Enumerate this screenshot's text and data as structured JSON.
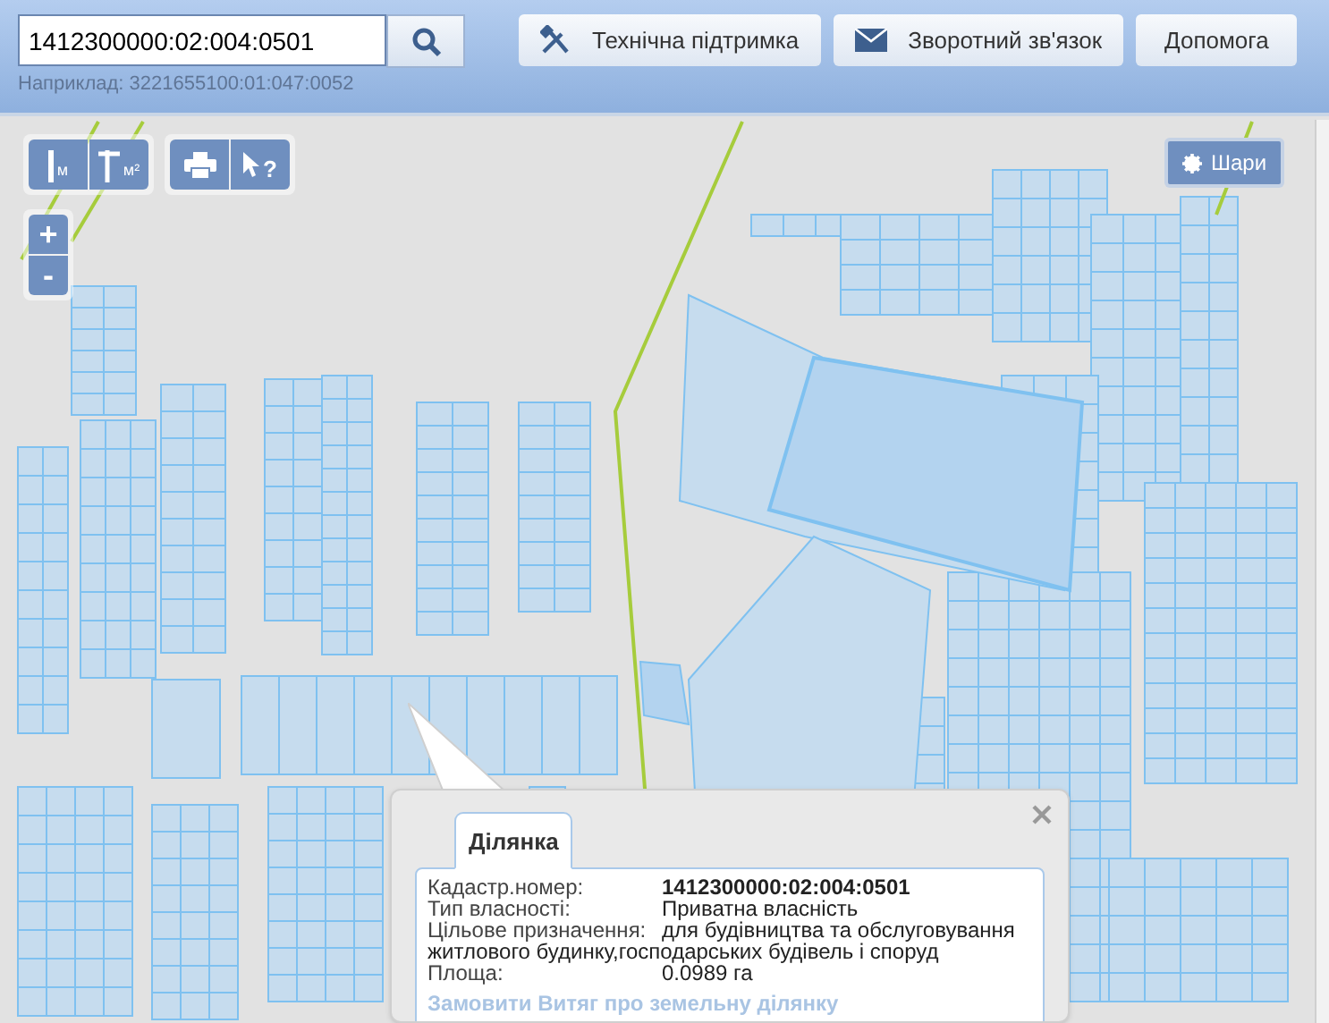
{
  "search": {
    "value": "1412300000:02:004:0501",
    "hint": "Наприклад: 3221655100:01:047:0052"
  },
  "header_buttons": [
    {
      "kind": "support",
      "label": "Технічна підтримка"
    },
    {
      "kind": "feedback",
      "label": "Зворотний зв'язок"
    },
    {
      "kind": "help",
      "label": "Допомога"
    }
  ],
  "measure_tools": [
    "м",
    "м²"
  ],
  "identify_tool": "?",
  "zoom": [
    "+",
    "-"
  ],
  "layers_button": "Шари",
  "popup": {
    "tabs": [
      {
        "label": "Ділянка",
        "selected": true
      }
    ],
    "fields": [
      {
        "label": "Кадастр.номер:",
        "value": "1412300000:02:004:0501",
        "bold": true
      },
      {
        "label": "Тип власності:",
        "value": "Приватна власність",
        "bold": false
      },
      {
        "label": "Цільове призначення:",
        "value": "для будівництва та обслуговування житлового будинку,господарських будівель і споруд",
        "bold": false
      },
      {
        "label": "Площа:",
        "value": "0.0989 га",
        "bold": false
      }
    ],
    "link": "Замовити Витяг про земельну ділянку"
  }
}
